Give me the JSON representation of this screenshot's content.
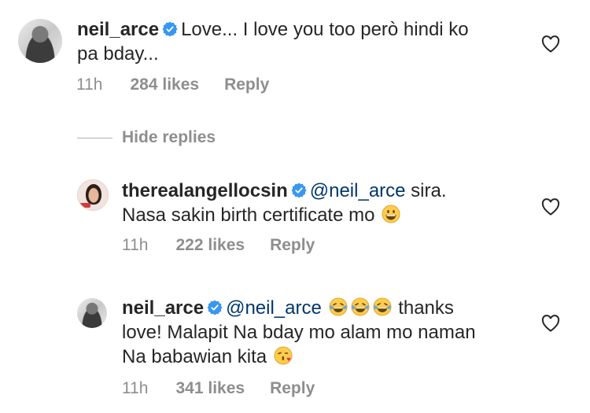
{
  "comments": [
    {
      "username": "neil_arce",
      "text_line1": "Love... I love you too però hindi ko",
      "text_line2": "pa bday...",
      "time": "11h",
      "likes": "284 likes",
      "reply": "Reply"
    },
    {
      "username": "therealangellocsin",
      "mention": "@neil_arce",
      "text_after_mention": " sira.",
      "text_line2": "Nasa sakin birth certificate mo",
      "time": "11h",
      "likes": "222 likes",
      "reply": "Reply"
    },
    {
      "username": "neil_arce",
      "mention": "@neil_arce",
      "text_after_emojis": "thanks",
      "text_line2": "love! Malapit Na bday mo alam mo naman",
      "text_line3": "Na babawian kita",
      "time": "11h",
      "likes": "341 likes",
      "reply": "Reply"
    }
  ],
  "hide_replies": "Hide replies",
  "colors": {
    "verified": "#3897f0",
    "secondary_text": "#8e8e8e",
    "mention": "#00376b"
  },
  "icons": [
    "verified-badge-icon",
    "heart-icon",
    "grinning-emoji",
    "tears-of-joy-emoji",
    "kiss-emoji"
  ]
}
